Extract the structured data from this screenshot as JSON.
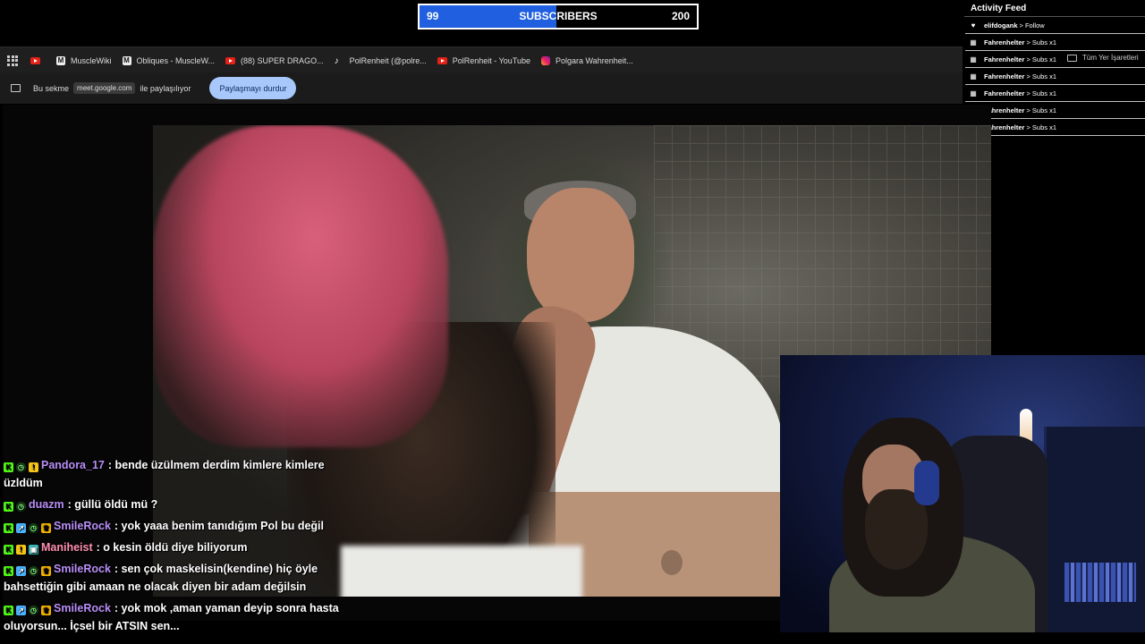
{
  "sub_goal": {
    "current": "99",
    "label": "SUBSCRIBERS",
    "target": "200",
    "progress_fraction": 0.495
  },
  "bookmarks": [
    {
      "label": "",
      "icon": "youtube-icon"
    },
    {
      "label": "MuscleWiki",
      "icon": "musclewiki-icon"
    },
    {
      "label": "Obliques - MuscleW...",
      "icon": "musclewiki-icon"
    },
    {
      "label": "(88) SUPER DRAGO...",
      "icon": "youtube-icon"
    },
    {
      "label": "PolRenheit (@polre...",
      "icon": "tiktok-icon"
    },
    {
      "label": "PolRenheit - YouTube",
      "icon": "youtube-icon"
    },
    {
      "label": "Polgara Wahrenheit...",
      "icon": "instagram-icon"
    }
  ],
  "share_bar": {
    "prefix": "Bu sekme",
    "url": "meet.google.com",
    "suffix": "ile paylaşılıyor",
    "stop_button": "Paylaşmayı durdur"
  },
  "activity_feed": {
    "title": "Activity Feed",
    "items": [
      {
        "user": "elifdogank",
        "action": "> Follow",
        "icon": "heart-icon"
      },
      {
        "user": "Fahrenhelter",
        "action": "> Subs x1",
        "icon": "gift-icon"
      },
      {
        "user": "Fahrenhelter",
        "action": "> Subs x1",
        "icon": "gift-icon"
      },
      {
        "user": "Fahrenhelter",
        "action": "> Subs x1",
        "icon": "gift-icon"
      },
      {
        "user": "Fahrenhelter",
        "action": "> Subs x1",
        "icon": "gift-icon"
      },
      {
        "user": "Fahrenhelter",
        "action": "> Subs x1",
        "icon": "gift-icon"
      },
      {
        "user": "Fahrenhelter",
        "action": "> Subs x1",
        "icon": "gift-icon"
      }
    ]
  },
  "bookmark_folder": "Tüm Yer İşaretleri",
  "chat": [
    {
      "user": "Pandora_17",
      "text": ": bende üzülmem derdim kimlere kimlere üzldüm",
      "color": "#b98ef8"
    },
    {
      "user": "duazm",
      "text": ": güllü öldü mü ?",
      "color": "#b98ef8"
    },
    {
      "user": "SmileRock",
      "text": ": yok yaaa benim tanıdığım Pol bu değil",
      "color": "#b98ef8"
    },
    {
      "user": "Maniheist",
      "text": ": o kesin öldü diye biliyorum",
      "color": "#ff8fb0"
    },
    {
      "user": "SmileRock",
      "text": ": sen çok maskelisin(kendine) hiç öyle bahsettiğin gibi amaan ne olacak diyen bir adam değilsin",
      "color": "#b98ef8"
    },
    {
      "user": "SmileRock",
      "text": ": yok mok ,aman yaman deyip sonra hasta oluyorsun... İçsel bir ATSIN sen...",
      "color": "#b98ef8"
    }
  ],
  "colors": {
    "goal_fill": "#1f5fe0",
    "share_button": "#a8c7fa",
    "kick_green": "#53fc18"
  }
}
